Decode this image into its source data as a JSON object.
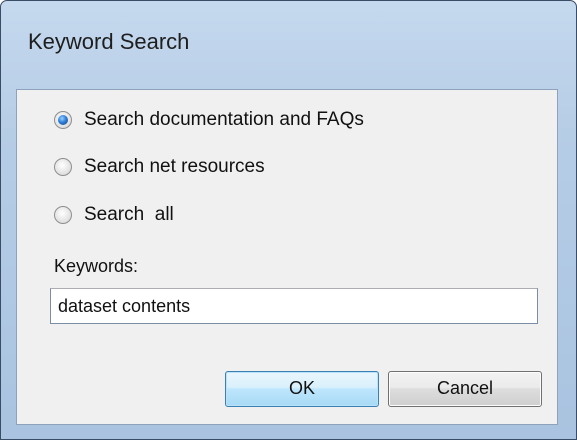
{
  "window": {
    "title": "Keyword Search"
  },
  "search_scope": {
    "options": [
      {
        "label": "Search documentation and FAQs",
        "checked": true
      },
      {
        "label": "Search net resources",
        "checked": false
      },
      {
        "label": "Search  all",
        "checked": false
      }
    ]
  },
  "keywords": {
    "label": "Keywords:",
    "value": "dataset contents"
  },
  "buttons": {
    "ok_label": "OK",
    "cancel_label": "Cancel"
  },
  "colors": {
    "title_bar": "#b6cde6",
    "client_background": "#f0f0f0",
    "default_button_border": "#3c7fb1"
  }
}
